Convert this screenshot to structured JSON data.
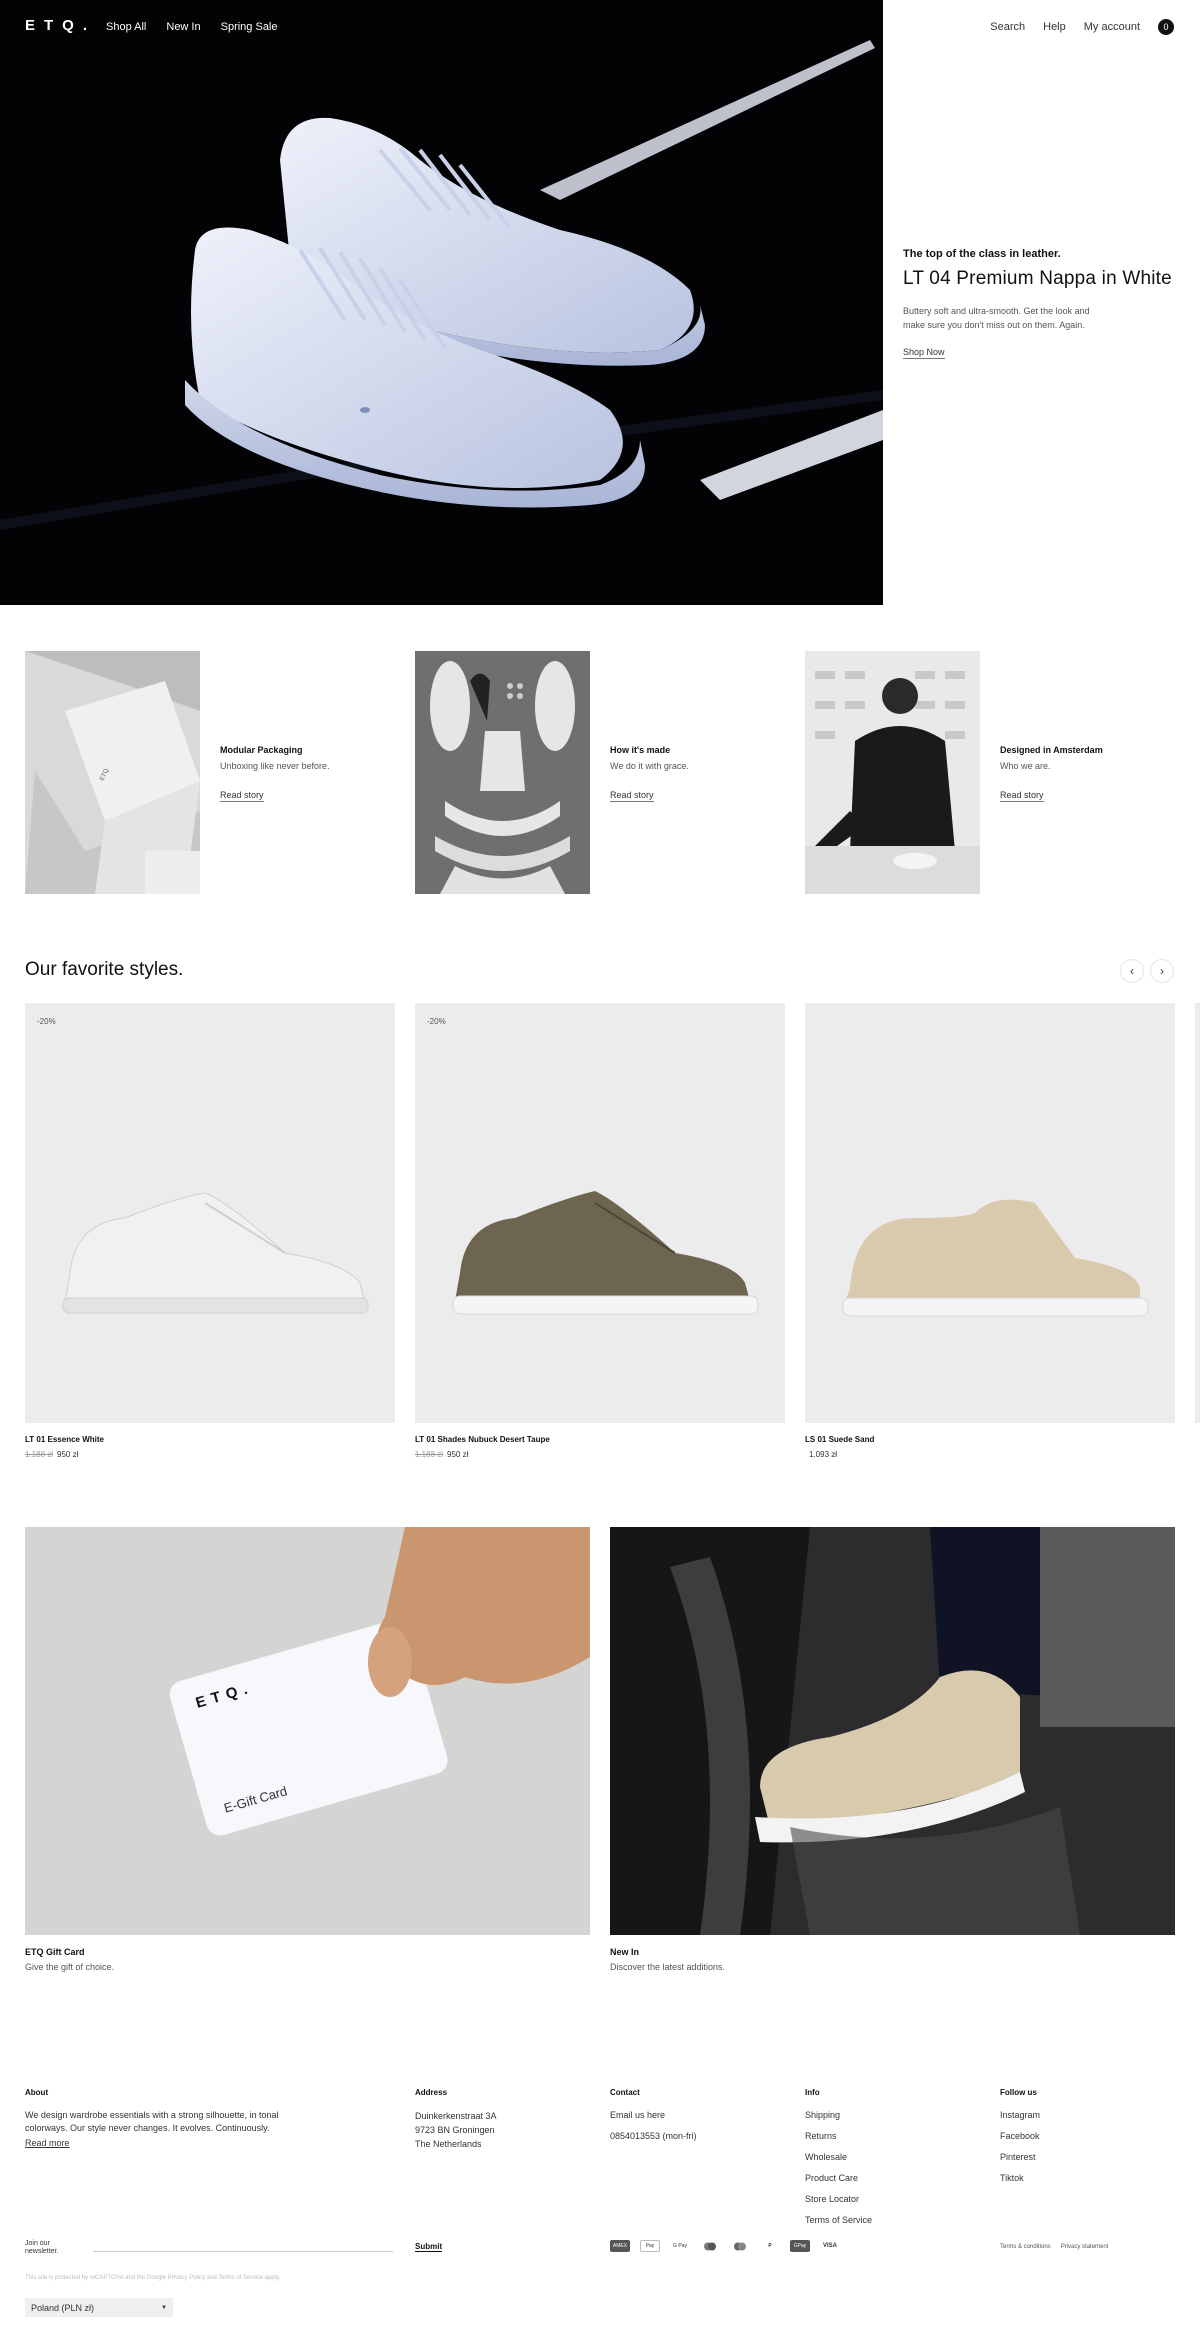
{
  "header": {
    "logo": "ETQ.",
    "nav_left": [
      "Shop All",
      "New In",
      "Spring Sale"
    ],
    "nav_right": [
      "Search",
      "Help",
      "My account"
    ],
    "cart_count": "0"
  },
  "hero": {
    "eyebrow": "The top of the class in leather.",
    "title": "LT 04 Premium Nappa in White",
    "description": "Buttery soft and ultra-smooth. Get the look and make sure you don't miss out on them. Again.",
    "link": "Shop Now"
  },
  "stories": [
    {
      "title": "Modular Packaging",
      "subtitle": "Unboxing like never before.",
      "link": "Read story"
    },
    {
      "title": "How it's made",
      "subtitle": "We do it with grace.",
      "link": "Read story"
    },
    {
      "title": "Designed in Amsterdam",
      "subtitle": "Who we are.",
      "link": "Read story"
    }
  ],
  "favorites": {
    "title": "Our favorite styles.",
    "prev_icon": "chevron-left-icon",
    "next_icon": "chevron-right-icon",
    "products": [
      {
        "badge": "-20%",
        "name": "LT 01 Essence White",
        "old_price": "1.188 zł",
        "price": "950 zł"
      },
      {
        "badge": "-20%",
        "name": "LT 01 Shades Nubuck Desert Taupe",
        "old_price": "1.188 zł",
        "price": "950 zł"
      },
      {
        "badge": "",
        "name": "LS 01 Suede Sand",
        "old_price": "",
        "price": "1.093 zł"
      }
    ]
  },
  "promos": [
    {
      "card_logo": "ETQ.",
      "card_text": "E-Gift Card",
      "title": "ETQ Gift Card",
      "subtitle": "Give the gift of choice."
    },
    {
      "title": "New In",
      "subtitle": "Discover the latest additions."
    }
  ],
  "footer": {
    "about": {
      "heading": "About",
      "text": "We design wardrobe essentials with a strong silhouette, in tonal colorways. Our style never changes. It evolves. Continuously.",
      "link": "Read more"
    },
    "address": {
      "heading": "Address",
      "lines": [
        "Duinkerkenstraat 3A",
        "9723 BN Groningen",
        "The Netherlands"
      ]
    },
    "contact": {
      "heading": "Contact",
      "lines": [
        "Email us here",
        "0854013553 (mon-fri)"
      ]
    },
    "info": {
      "heading": "Info",
      "links": [
        "Shipping",
        "Returns",
        "Wholesale",
        "Product Care",
        "Store Locator",
        "Terms of Service"
      ]
    },
    "follow": {
      "heading": "Follow us",
      "links": [
        "Instagram",
        "Facebook",
        "Pinterest",
        "Tiktok"
      ]
    },
    "newsletter": {
      "label": "Join our newsletter.",
      "placeholder": "",
      "submit": "Submit"
    },
    "payments": [
      "AMEX",
      "Pay",
      "G Pay",
      "MC",
      "Maestro",
      "PayPal",
      "GPay",
      "VISA"
    ],
    "legal": [
      "Terms & conditions",
      "Privacy statement"
    ],
    "recaptcha": "This site is protected by reCAPTCHA and the Google Privacy Policy and Terms of Service apply.",
    "country": "Poland (PLN zł)"
  }
}
